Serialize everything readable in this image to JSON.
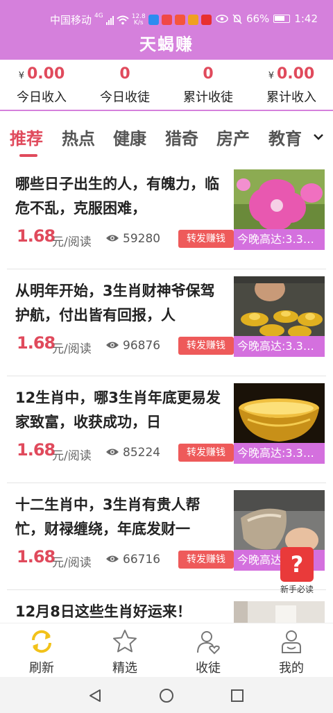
{
  "status_bar": {
    "carrier": "中国移动",
    "signal_type": "4G",
    "speed_value": "12.8",
    "speed_unit": "K/s",
    "battery": "66%",
    "time": "1:42"
  },
  "app_title": "天蝎赚",
  "stats": [
    {
      "value": "0.00",
      "currency": "¥",
      "label": "今日收入"
    },
    {
      "value": "0",
      "currency": "",
      "label": "今日收徒"
    },
    {
      "value": "0",
      "currency": "",
      "label": "累计收徒"
    },
    {
      "value": "0.00",
      "currency": "¥",
      "label": "累计收入"
    }
  ],
  "tabs": [
    "推荐",
    "热点",
    "健康",
    "猎奇",
    "房产",
    "教育"
  ],
  "articles": [
    {
      "title": "哪些日子出生的人，有魄力，临危不乱，克服困难，",
      "price": "1.68",
      "unit": "元/阅读",
      "views": "59280",
      "share_label": "转发赚钱",
      "thumb_caption": "今晚高达:3.3…",
      "thumb_icon": "pink-flower-photo"
    },
    {
      "title": "从明年开始，3生肖财神爷保驾护航，付出皆有回报，人",
      "price": "1.68",
      "unit": "元/阅读",
      "views": "96876",
      "share_label": "转发赚钱",
      "thumb_caption": "今晚高达:3.3…",
      "thumb_icon": "gold-ingots-photo"
    },
    {
      "title": "12生肖中，哪3生肖年底更易发家致富，收获成功，日",
      "price": "1.68",
      "unit": "元/阅读",
      "views": "85224",
      "share_label": "转发赚钱",
      "thumb_caption": "今晚高达:3.3…",
      "thumb_icon": "gold-bowl-photo"
    },
    {
      "title": "十二生肖中，3生肖有贵人帮忙，财禄缠绕，年底发财一",
      "price": "1.68",
      "unit": "元/阅读",
      "views": "66716",
      "share_label": "转发赚钱",
      "thumb_caption": "今晚高达:3.3…",
      "thumb_icon": "silver-ingot-photo"
    },
    {
      "title": "12月8日这些生肖好运来！",
      "thumb_icon": "room-photo"
    }
  ],
  "help_badge": {
    "icon": "?",
    "label": "新手必读"
  },
  "bottom_nav": [
    {
      "label": "刷新",
      "icon": "refresh-icon",
      "active": true
    },
    {
      "label": "精选",
      "icon": "star-icon"
    },
    {
      "label": "收徒",
      "icon": "user-heart-icon"
    },
    {
      "label": "我的",
      "icon": "profile-icon"
    }
  ],
  "colors": {
    "brand": "#d580dc",
    "accent": "#e04a5c",
    "share": "#ee5a5a",
    "nav_active": "#f2c21a"
  }
}
